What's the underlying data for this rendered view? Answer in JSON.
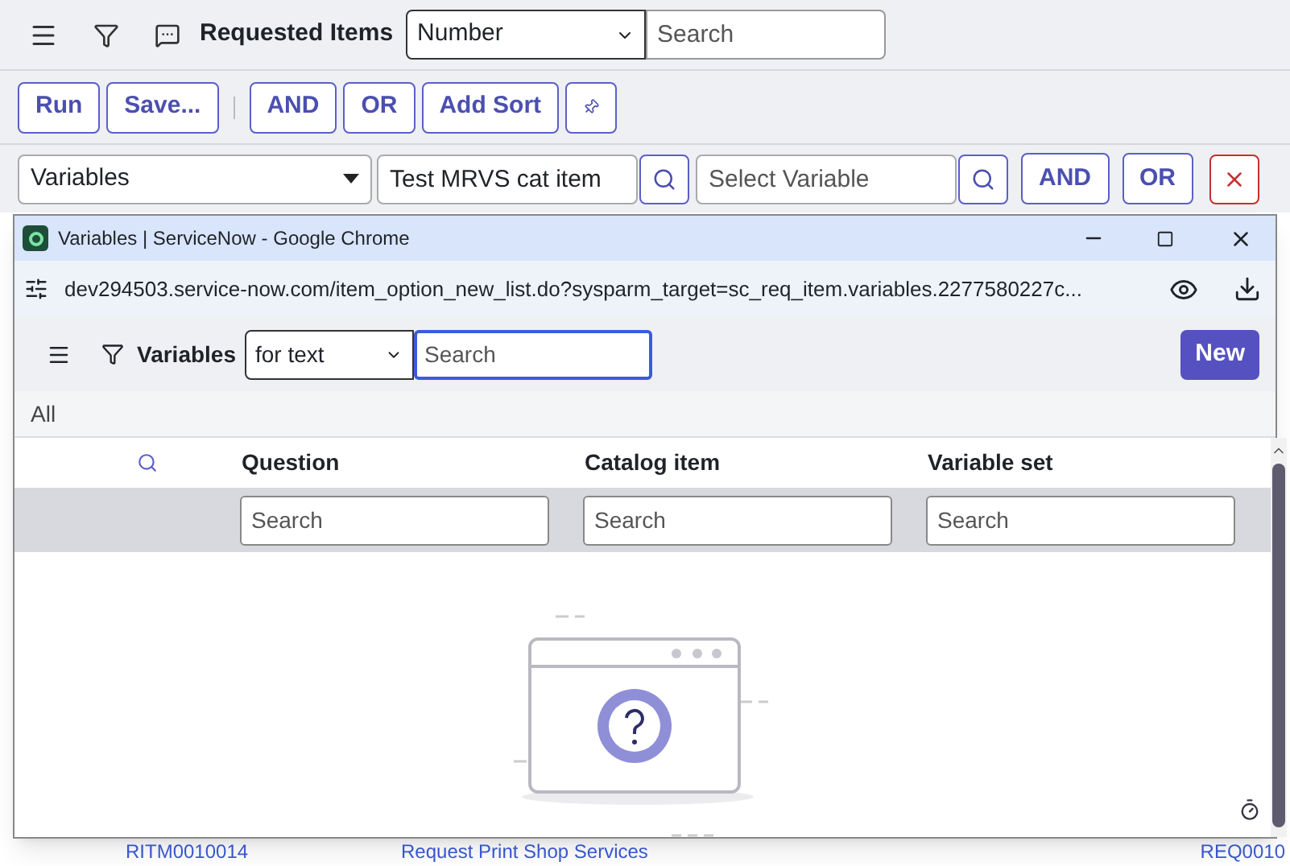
{
  "header": {
    "title": "Requested Items",
    "field_select": "Number",
    "search": {
      "placeholder": "Search"
    }
  },
  "actions": [
    "Run",
    "Save...",
    "AND",
    "OR",
    "Add Sort"
  ],
  "condition": {
    "field": "Variables",
    "value": "Test MRVS cat item",
    "variable": {
      "placeholder": "Select Variable"
    },
    "buttons": [
      "AND",
      "OR"
    ]
  },
  "background_row": {
    "number": "RITM0010014",
    "item": "Request Print Shop Services",
    "request": "REQ0010"
  },
  "popup": {
    "window_title": "Variables | ServiceNow - Google Chrome",
    "url": "dev294503.service-now.com/item_option_new_list.do?sysparm_target=sc_req_item.variables.2277580227c...",
    "list_title": "Variables",
    "field_select": "for text",
    "search": {
      "placeholder": "Search"
    },
    "new_button": "New",
    "breadcrumb": "All",
    "columns": [
      {
        "label": "Question",
        "placeholder": "Search"
      },
      {
        "label": "Catalog item",
        "placeholder": "Search"
      },
      {
        "label": "Variable set",
        "placeholder": "Search"
      }
    ]
  }
}
